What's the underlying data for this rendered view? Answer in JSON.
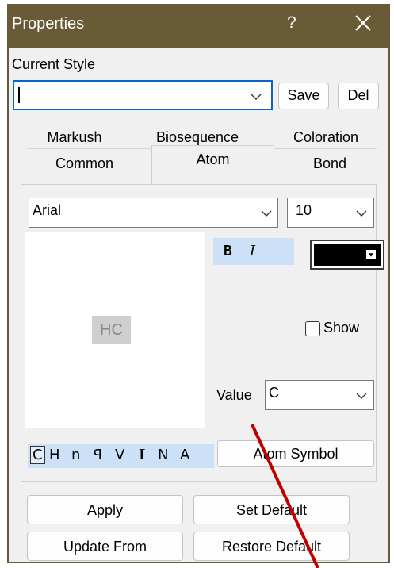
{
  "window": {
    "title": "Properties",
    "help_label": "?"
  },
  "current_style": {
    "label": "Current Style",
    "value": "",
    "save_label": "Save",
    "del_label": "Del"
  },
  "tabs": {
    "row1": [
      "Markush",
      "Biosequence",
      "Coloration"
    ],
    "row2": [
      "Common",
      "Atom",
      "Bond"
    ],
    "active": "Atom"
  },
  "font": {
    "family": "Arial",
    "size": "10"
  },
  "format": {
    "bold_label": "B",
    "italic_label": "I",
    "color": "#000000"
  },
  "preview": {
    "text": "HC"
  },
  "show": {
    "label": "Show",
    "checked": false
  },
  "value": {
    "label": "Value",
    "current": "C"
  },
  "symbols": {
    "items": [
      "C",
      "H",
      "n",
      "ꟼ",
      "V",
      "I",
      "N",
      "A"
    ],
    "selected": "C",
    "atom_symbol_label": "Atom Symbol"
  },
  "actions": {
    "apply": "Apply",
    "set_default": "Set Default",
    "update_from": "Update From",
    "restore_default": "Restore Default"
  },
  "colors": {
    "titlebar": "#6a5b37",
    "highlight": "#cce0f7",
    "focus_border": "#0a64c8",
    "annotation": "#c00000"
  }
}
